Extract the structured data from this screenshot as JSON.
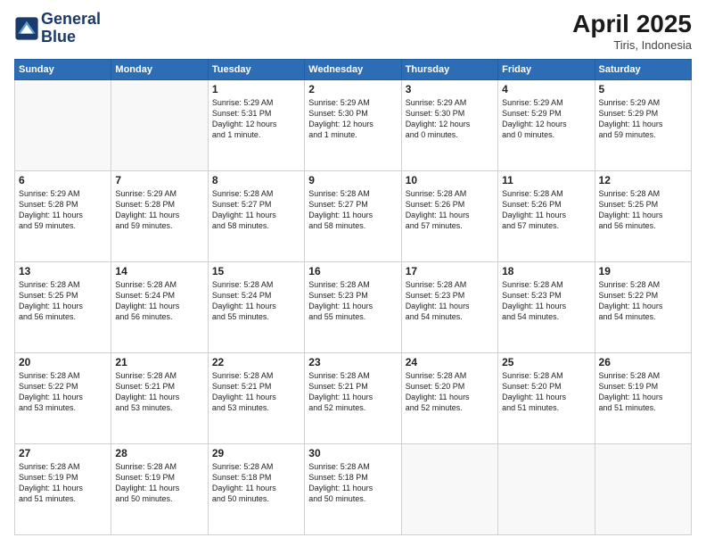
{
  "header": {
    "logo_line1": "General",
    "logo_line2": "Blue",
    "month": "April 2025",
    "location": "Tiris, Indonesia"
  },
  "weekdays": [
    "Sunday",
    "Monday",
    "Tuesday",
    "Wednesday",
    "Thursday",
    "Friday",
    "Saturday"
  ],
  "weeks": [
    [
      {
        "day": "",
        "text": ""
      },
      {
        "day": "",
        "text": ""
      },
      {
        "day": "1",
        "text": "Sunrise: 5:29 AM\nSunset: 5:31 PM\nDaylight: 12 hours\nand 1 minute."
      },
      {
        "day": "2",
        "text": "Sunrise: 5:29 AM\nSunset: 5:30 PM\nDaylight: 12 hours\nand 1 minute."
      },
      {
        "day": "3",
        "text": "Sunrise: 5:29 AM\nSunset: 5:30 PM\nDaylight: 12 hours\nand 0 minutes."
      },
      {
        "day": "4",
        "text": "Sunrise: 5:29 AM\nSunset: 5:29 PM\nDaylight: 12 hours\nand 0 minutes."
      },
      {
        "day": "5",
        "text": "Sunrise: 5:29 AM\nSunset: 5:29 PM\nDaylight: 11 hours\nand 59 minutes."
      }
    ],
    [
      {
        "day": "6",
        "text": "Sunrise: 5:29 AM\nSunset: 5:28 PM\nDaylight: 11 hours\nand 59 minutes."
      },
      {
        "day": "7",
        "text": "Sunrise: 5:29 AM\nSunset: 5:28 PM\nDaylight: 11 hours\nand 59 minutes."
      },
      {
        "day": "8",
        "text": "Sunrise: 5:28 AM\nSunset: 5:27 PM\nDaylight: 11 hours\nand 58 minutes."
      },
      {
        "day": "9",
        "text": "Sunrise: 5:28 AM\nSunset: 5:27 PM\nDaylight: 11 hours\nand 58 minutes."
      },
      {
        "day": "10",
        "text": "Sunrise: 5:28 AM\nSunset: 5:26 PM\nDaylight: 11 hours\nand 57 minutes."
      },
      {
        "day": "11",
        "text": "Sunrise: 5:28 AM\nSunset: 5:26 PM\nDaylight: 11 hours\nand 57 minutes."
      },
      {
        "day": "12",
        "text": "Sunrise: 5:28 AM\nSunset: 5:25 PM\nDaylight: 11 hours\nand 56 minutes."
      }
    ],
    [
      {
        "day": "13",
        "text": "Sunrise: 5:28 AM\nSunset: 5:25 PM\nDaylight: 11 hours\nand 56 minutes."
      },
      {
        "day": "14",
        "text": "Sunrise: 5:28 AM\nSunset: 5:24 PM\nDaylight: 11 hours\nand 56 minutes."
      },
      {
        "day": "15",
        "text": "Sunrise: 5:28 AM\nSunset: 5:24 PM\nDaylight: 11 hours\nand 55 minutes."
      },
      {
        "day": "16",
        "text": "Sunrise: 5:28 AM\nSunset: 5:23 PM\nDaylight: 11 hours\nand 55 minutes."
      },
      {
        "day": "17",
        "text": "Sunrise: 5:28 AM\nSunset: 5:23 PM\nDaylight: 11 hours\nand 54 minutes."
      },
      {
        "day": "18",
        "text": "Sunrise: 5:28 AM\nSunset: 5:23 PM\nDaylight: 11 hours\nand 54 minutes."
      },
      {
        "day": "19",
        "text": "Sunrise: 5:28 AM\nSunset: 5:22 PM\nDaylight: 11 hours\nand 54 minutes."
      }
    ],
    [
      {
        "day": "20",
        "text": "Sunrise: 5:28 AM\nSunset: 5:22 PM\nDaylight: 11 hours\nand 53 minutes."
      },
      {
        "day": "21",
        "text": "Sunrise: 5:28 AM\nSunset: 5:21 PM\nDaylight: 11 hours\nand 53 minutes."
      },
      {
        "day": "22",
        "text": "Sunrise: 5:28 AM\nSunset: 5:21 PM\nDaylight: 11 hours\nand 53 minutes."
      },
      {
        "day": "23",
        "text": "Sunrise: 5:28 AM\nSunset: 5:21 PM\nDaylight: 11 hours\nand 52 minutes."
      },
      {
        "day": "24",
        "text": "Sunrise: 5:28 AM\nSunset: 5:20 PM\nDaylight: 11 hours\nand 52 minutes."
      },
      {
        "day": "25",
        "text": "Sunrise: 5:28 AM\nSunset: 5:20 PM\nDaylight: 11 hours\nand 51 minutes."
      },
      {
        "day": "26",
        "text": "Sunrise: 5:28 AM\nSunset: 5:19 PM\nDaylight: 11 hours\nand 51 minutes."
      }
    ],
    [
      {
        "day": "27",
        "text": "Sunrise: 5:28 AM\nSunset: 5:19 PM\nDaylight: 11 hours\nand 51 minutes."
      },
      {
        "day": "28",
        "text": "Sunrise: 5:28 AM\nSunset: 5:19 PM\nDaylight: 11 hours\nand 50 minutes."
      },
      {
        "day": "29",
        "text": "Sunrise: 5:28 AM\nSunset: 5:18 PM\nDaylight: 11 hours\nand 50 minutes."
      },
      {
        "day": "30",
        "text": "Sunrise: 5:28 AM\nSunset: 5:18 PM\nDaylight: 11 hours\nand 50 minutes."
      },
      {
        "day": "",
        "text": ""
      },
      {
        "day": "",
        "text": ""
      },
      {
        "day": "",
        "text": ""
      }
    ]
  ]
}
